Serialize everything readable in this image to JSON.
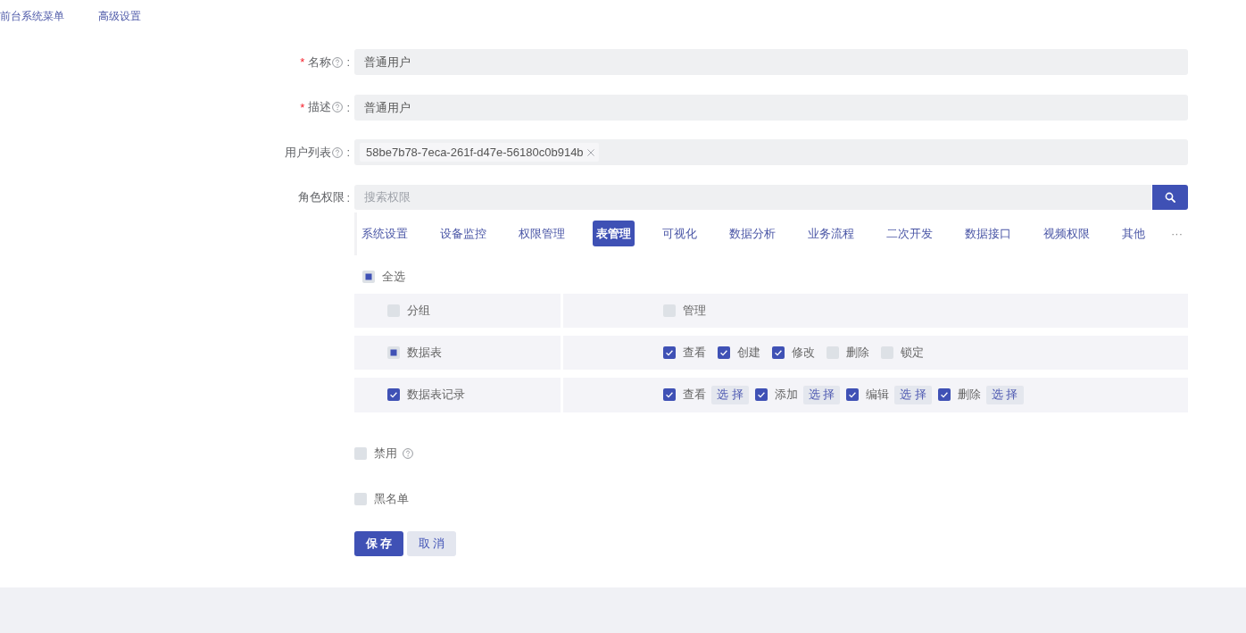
{
  "nav_tabs": [
    {
      "label": "前台系统菜单"
    },
    {
      "label": "高级设置"
    }
  ],
  "form": {
    "fields": [
      {
        "kind": "text",
        "required_mark": "*",
        "label": "名称",
        "help": true,
        "colon": ":",
        "value": "普通用户"
      },
      {
        "kind": "text",
        "required_mark": "*",
        "label": "描述",
        "help": true,
        "colon": ":",
        "value": "普通用户"
      },
      {
        "kind": "tags",
        "label": "用户列表",
        "help": true,
        "colon": ":",
        "tags": [
          "58be7b78-7eca-261f-d47e-56180c0b914b"
        ]
      },
      {
        "kind": "permissions",
        "label": "角色权限",
        "colon": ":",
        "search": {
          "placeholder": "搜索权限"
        },
        "tabs": [
          {
            "label": "系统设置",
            "selected": false
          },
          {
            "label": "设备监控",
            "selected": false
          },
          {
            "label": "权限管理",
            "selected": false
          },
          {
            "label": "表管理",
            "selected": true
          },
          {
            "label": "可视化",
            "selected": false
          },
          {
            "label": "数据分析",
            "selected": false
          },
          {
            "label": "业务流程",
            "selected": false
          },
          {
            "label": "二次开发",
            "selected": false
          },
          {
            "label": "数据接口",
            "selected": false
          },
          {
            "label": "视频权限",
            "selected": false
          },
          {
            "label": "其他",
            "selected": false
          }
        ],
        "more": "···",
        "select_all": {
          "label": "全选",
          "indeterminate": true
        },
        "rows": [
          {
            "group": {
              "label": "分组",
              "checked": false,
              "indeterminate": false
            },
            "actions": [
              {
                "label": "管理",
                "checked": false
              }
            ]
          },
          {
            "group": {
              "label": "数据表",
              "indeterminate": true
            },
            "actions": [
              {
                "label": "查看",
                "checked": true
              },
              {
                "label": "创建",
                "checked": true
              },
              {
                "label": "修改",
                "checked": true
              },
              {
                "label": "删除",
                "checked": false
              },
              {
                "label": "锁定",
                "checked": false
              }
            ]
          },
          {
            "group": {
              "label": "数据表记录",
              "checked": true,
              "indeterminate": false
            },
            "actions": [
              {
                "label": "查看",
                "checked": true,
                "select_button": "选 择"
              },
              {
                "label": "添加",
                "checked": true,
                "select_button": "选 择"
              },
              {
                "label": "编辑",
                "checked": true,
                "select_button": "选 择"
              },
              {
                "label": "删除",
                "checked": true,
                "select_button": "选 择"
              }
            ]
          }
        ]
      }
    ],
    "options": [
      {
        "label": "禁用",
        "checked": false,
        "help": true
      },
      {
        "label": "黑名单",
        "checked": false
      }
    ],
    "buttons": [
      {
        "kind": "primary",
        "label": "保 存"
      },
      {
        "kind": "default",
        "label": "取 消"
      }
    ]
  }
}
